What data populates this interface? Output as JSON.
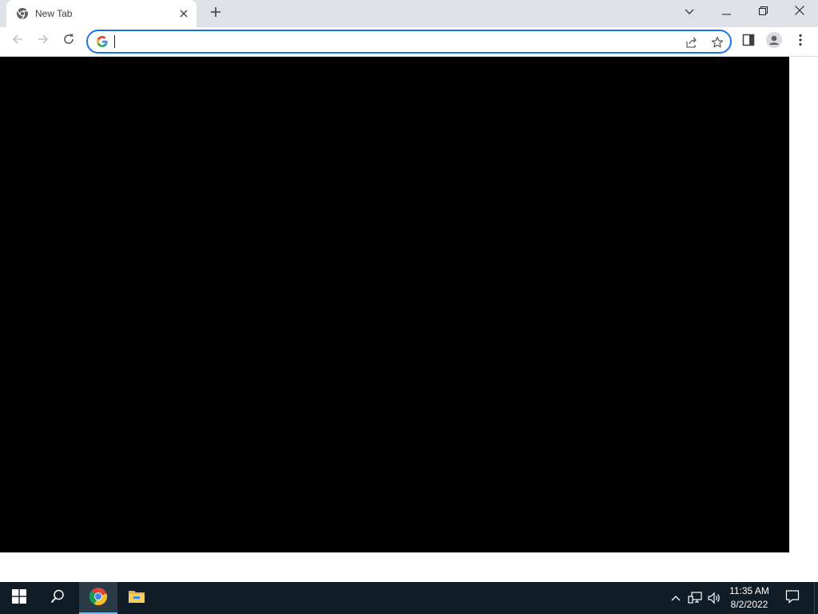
{
  "browser": {
    "tab": {
      "title": "New Tab",
      "icon": "chrome-icon"
    },
    "new_tab_icon": "plus-icon",
    "window_controls": {
      "tab_search_icon": "chevron-down-icon",
      "minimize_icon": "minimize-icon",
      "restore_icon": "restore-icon",
      "close_icon": "close-icon"
    },
    "toolbar": {
      "back_icon": "back-arrow-icon",
      "forward_icon": "forward-arrow-icon",
      "reload_icon": "reload-icon",
      "omnibox": {
        "value": "",
        "placeholder": "",
        "leading_icon": "google-g-icon"
      },
      "share_icon": "share-icon",
      "bookmark_icon": "star-icon",
      "side_panel_icon": "side-panel-icon",
      "profile_icon": "profile-icon",
      "menu_icon": "kebab-menu-icon"
    },
    "content": {
      "background": "#000000"
    }
  },
  "taskbar": {
    "start_icon": "windows-start-icon",
    "search_icon": "search-icon",
    "pinned": [
      {
        "name": "Google Chrome",
        "icon": "chrome-icon",
        "active": true
      },
      {
        "name": "File Explorer",
        "icon": "folder-icon",
        "active": false
      }
    ],
    "tray": {
      "overflow_icon": "chevron-up-icon",
      "network_icon": "network-icon",
      "volume_icon": "volume-icon"
    },
    "clock": {
      "time": "11:35 AM",
      "date": "8/2/2022"
    },
    "notification_icon": "notification-icon"
  },
  "colors": {
    "accent": "#1a73e8",
    "tabstrip": "#dee1e6",
    "taskbar": "#101c26",
    "taskbar_active_bar": "#76b9ed"
  }
}
